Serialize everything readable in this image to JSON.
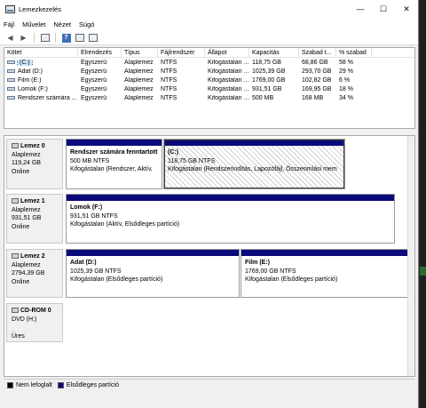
{
  "window": {
    "title": "Lemezkezelés"
  },
  "menu": [
    "Fájl",
    "Művelet",
    "Nézet",
    "Súgó"
  ],
  "volume_table": {
    "columns": [
      "Kötet",
      "Elrendezés",
      "Típus",
      "Fájlrendszer",
      "Állapot",
      "Kapacitás",
      "Szabad t...",
      "% szabad"
    ],
    "rows": [
      {
        "name": "(C:)",
        "layout": "Egyszerű",
        "type": "Alaplemez",
        "fs": "NTFS",
        "status": "Kifogástalan ...",
        "capacity": "118,75 GB",
        "free": "68,86 GB",
        "pct": "58 %"
      },
      {
        "name": "Adat (D:)",
        "layout": "Egyszerű",
        "type": "Alaplemez",
        "fs": "NTFS",
        "status": "Kifogástalan ...",
        "capacity": "1025,39 GB",
        "free": "293,70 GB",
        "pct": "29 %"
      },
      {
        "name": "Film (E:)",
        "layout": "Egyszerű",
        "type": "Alaplemez",
        "fs": "NTFS",
        "status": "Kifogástalan ...",
        "capacity": "1769,00 GB",
        "free": "102,82 GB",
        "pct": "6 %"
      },
      {
        "name": "Lomok (F:)",
        "layout": "Egyszerű",
        "type": "Alaplemez",
        "fs": "NTFS",
        "status": "Kifogástalan ...",
        "capacity": "931,51 GB",
        "free": "169,95 GB",
        "pct": "18 %"
      },
      {
        "name": "Rendszer számára ...",
        "layout": "Egyszerű",
        "type": "Alaplemez",
        "fs": "NTFS",
        "status": "Kifogástalan ...",
        "capacity": "500 MB",
        "free": "168 MB",
        "pct": "34 %"
      }
    ]
  },
  "disks": {
    "d0": {
      "name": "Lemez 0",
      "type": "Alaplemez",
      "size": "119,24 GB",
      "state": "Online",
      "p1": {
        "title": "Rendszer számára fenntartott",
        "size": "500 MB NTFS",
        "status": "Kifogástalan (Rendszer, Aktív, "
      },
      "p2": {
        "title": "(C:)",
        "size": "118,75 GB NTFS",
        "status": "Kifogástalan (Rendszerindítás, Lapozófájl, Összeomlási mem"
      }
    },
    "d1": {
      "name": "Lemez 1",
      "type": "Alaplemez",
      "size": "931,51 GB",
      "state": "Online",
      "p1": {
        "title": "Lomok  (F:)",
        "size": "931,51 GB NTFS",
        "status": "Kifogástalan (Aktív, Elsődleges partíció)"
      }
    },
    "d2": {
      "name": "Lemez 2",
      "type": "Alaplemez",
      "size": "2794,39 GB",
      "state": "Online",
      "p1": {
        "title": "Adat  (D:)",
        "size": "1025,39 GB NTFS",
        "status": "Kifogástalan (Elsődleges partíció)"
      },
      "p2": {
        "title": "Film  (E:)",
        "size": "1769,00 GB NTFS",
        "status": "Kifogástalan (Elsődleges partíció)"
      }
    },
    "cd": {
      "name": "CD-ROM 0",
      "type": "DVD (H:)",
      "state": "Üres"
    }
  },
  "legend": {
    "unallocated": "Nem lefoglalt",
    "primary": "Elsődleges partíció",
    "colors": {
      "unallocated": "#000000",
      "primary": "#0a0a7a"
    }
  }
}
